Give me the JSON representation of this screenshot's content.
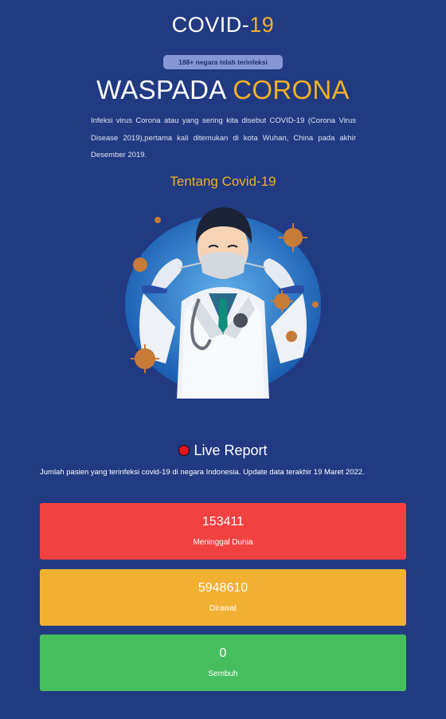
{
  "header": {
    "title_main": "COVID-",
    "title_accent": "19",
    "badge": "188+ negara telah terinfeksi",
    "headline_main": "WASPADA ",
    "headline_accent": "CORONA",
    "intro": "Infeksi virus Corona atau yang sering kita disebut COVID-19 (Corona Virus Disease 2019),pertama kali ditemukan di kota Wuhan, China pada akhir Desember 2019.",
    "about_link": "Tentang Covid-19"
  },
  "illustration": {
    "icon": "doctor-mask-virus-illustration"
  },
  "live_report": {
    "title": "Live Report",
    "update_text": "Jumlah pasien yang terinfeksi covid-19 di negara Indonesia. Update data terakhir 19 Maret 2022."
  },
  "stats": {
    "deaths": {
      "value": "153411",
      "label": "Meninggal Dunia",
      "color": "#f24141"
    },
    "treated": {
      "value": "5948610",
      "label": "Dirawat",
      "color": "#f2b033"
    },
    "recovered": {
      "value": "0",
      "label": "Sembuh",
      "color": "#46be5e"
    }
  },
  "colors": {
    "background": "#213a82",
    "accent": "#f2b123"
  }
}
